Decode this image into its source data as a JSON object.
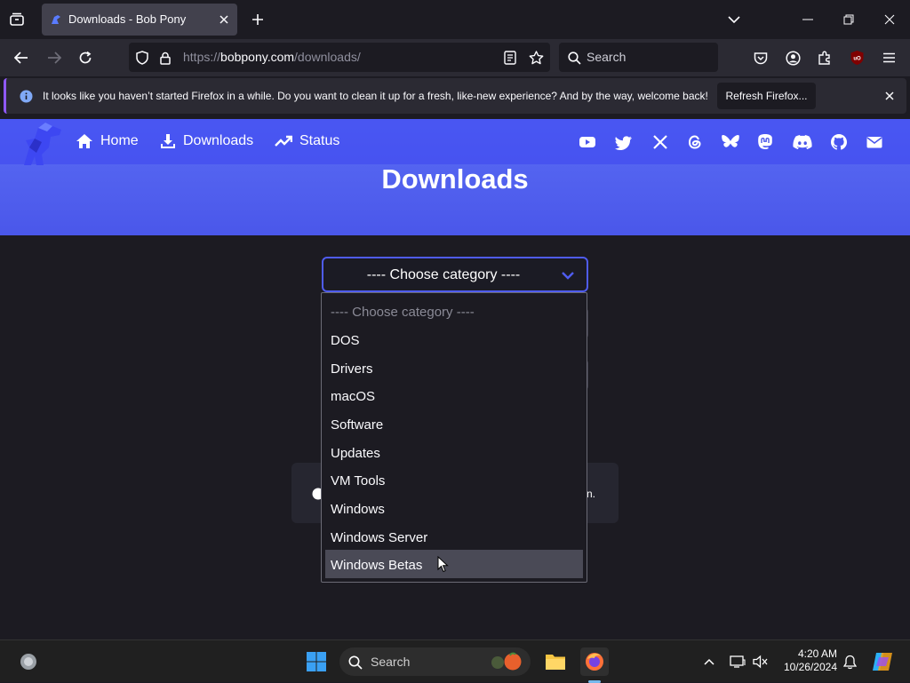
{
  "browser": {
    "tab_title": "Downloads - Bob Pony",
    "url_scheme": "https://",
    "url_host": "bobpony.com",
    "url_path": "/downloads/",
    "search_placeholder": "Search"
  },
  "notification": {
    "message": "It looks like you haven’t started Firefox in a while. Do you want to clean it up for a fresh, like-new experience? And by the way, welcome back!",
    "button_label": "Refresh Firefox..."
  },
  "site": {
    "nav": [
      {
        "label": "Home",
        "icon": "home-icon"
      },
      {
        "label": "Downloads",
        "icon": "download-icon"
      },
      {
        "label": "Status",
        "icon": "trend-icon"
      }
    ],
    "social_icons": [
      "youtube-icon",
      "twitter-icon",
      "x-icon",
      "threads-icon",
      "bluesky-icon",
      "mastodon-icon",
      "discord-icon",
      "github-icon",
      "email-icon"
    ],
    "page_title": "Downloads",
    "accent_color": "#4f5cf0"
  },
  "category_select": {
    "selected": "---- Choose category ----",
    "options": [
      "---- Choose category ----",
      "DOS",
      "Drivers",
      "macOS",
      "Software",
      "Updates",
      "VM Tools",
      "Windows",
      "Windows Server",
      "Windows Betas"
    ],
    "highlighted": "Windows Betas"
  },
  "hidden_card_text": "n.",
  "taskbar": {
    "search_placeholder": "Search",
    "time": "4:20 AM",
    "date": "10/26/2024"
  }
}
